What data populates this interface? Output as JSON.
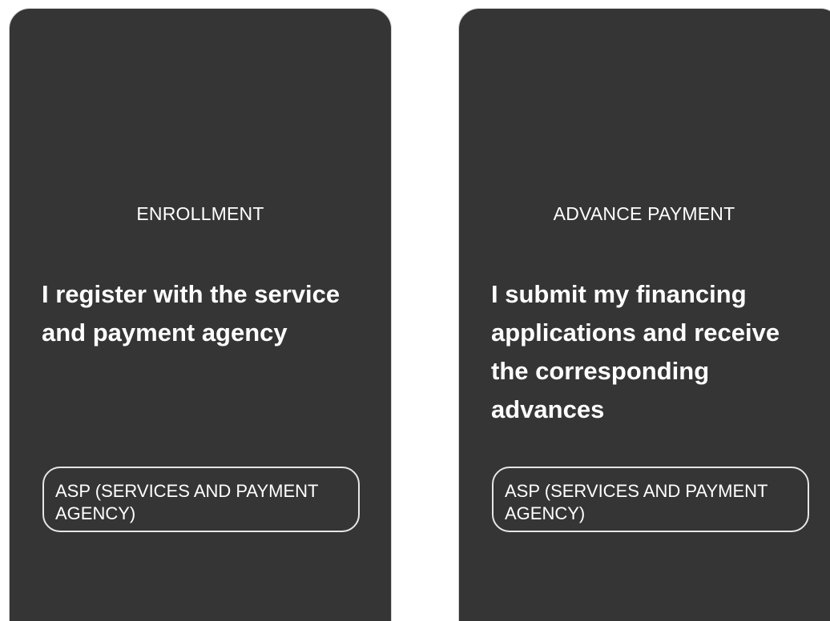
{
  "cards": [
    {
      "step_title": "ENROLLMENT",
      "description": "I register with the service and payment agency",
      "agency_label": "ASP (SERVICES AND PAYMENT AGENCY)"
    },
    {
      "step_title": "ADVANCE PAYMENT",
      "description": "I submit my financing applications and receive the corresponding advances",
      "agency_label": "ASP (SERVICES AND PAYMENT AGENCY)"
    }
  ],
  "colors": {
    "card_background": "#353535",
    "text": "#ffffff",
    "pill_border": "#e6e6e6",
    "page_background": "#ffffff"
  }
}
